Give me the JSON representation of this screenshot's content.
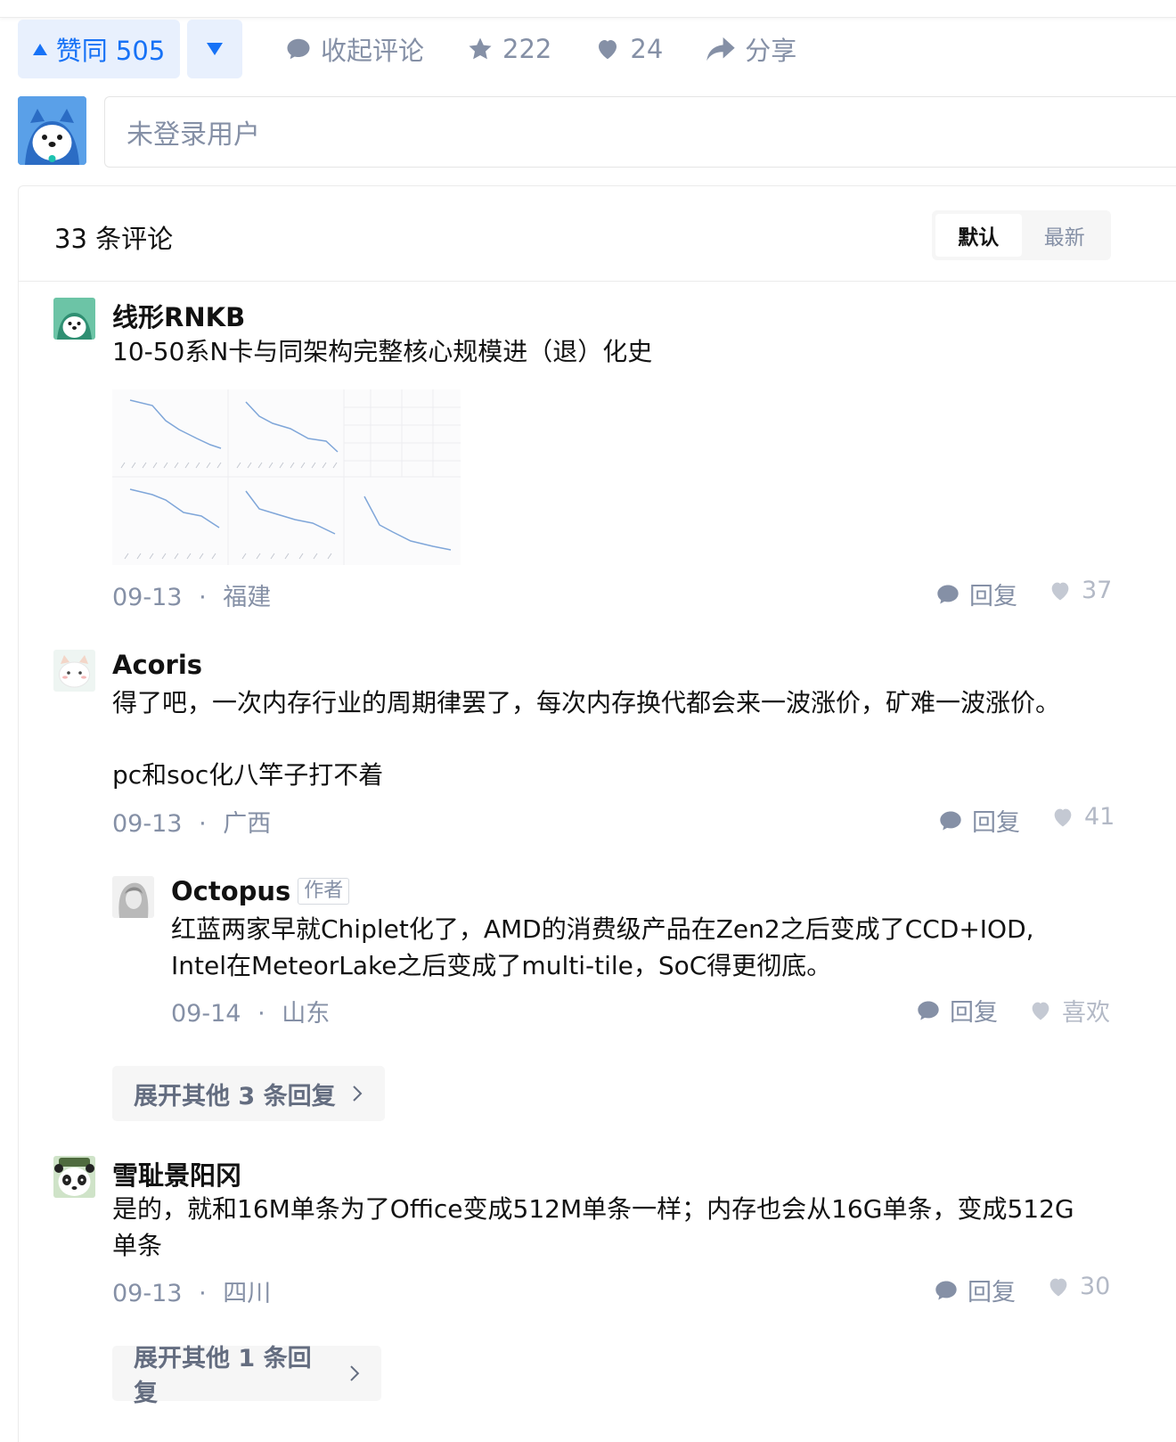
{
  "actions": {
    "upvote_label": "赞同 505",
    "collapse_label": "收起评论",
    "star_count": "222",
    "like_count": "24",
    "share_label": "分享"
  },
  "comment_input": {
    "placeholder": "未登录用户"
  },
  "comments_header": {
    "count_label": "33 条评论",
    "sort_default": "默认",
    "sort_latest": "最新"
  },
  "comments": [
    {
      "user": "线形RNKB",
      "text": "10-50系N卡与同架构完整核心规模进（退）化史",
      "date": "09-13",
      "location": "福建",
      "reply_label": "回复",
      "likes": "37"
    },
    {
      "user": "Acoris",
      "text1": "得了吧，一次内存行业的周期律罢了，每次内存换代都会来一波涨价，矿难一波涨价。",
      "text2": "pc和soc化八竿子打不着",
      "date": "09-13",
      "location": "广西",
      "reply_label": "回复",
      "likes": "41"
    },
    {
      "user": "Octopus",
      "tag": "作者",
      "text1": "红蓝两家早就Chiplet化了，AMD的消费级产品在Zen2之后变成了CCD+IOD,",
      "text2": "Intel在MeteorLake之后变成了multi-tile，SoC得更彻底。",
      "date": "09-14",
      "location": "山东",
      "reply_label": "回复",
      "likes": "喜欢"
    },
    {
      "user": "雪耻景阳冈",
      "text1": "是的，就和16M单条为了Office变成512M单条一样；内存也会从16G单条，变成512G",
      "text2": "单条",
      "date": "09-13",
      "location": "四川",
      "reply_label": "回复",
      "likes": "30"
    }
  ],
  "expand_1": "展开其他 3 条回复",
  "expand_2": "展开其他 1 条回复",
  "dot": "·"
}
